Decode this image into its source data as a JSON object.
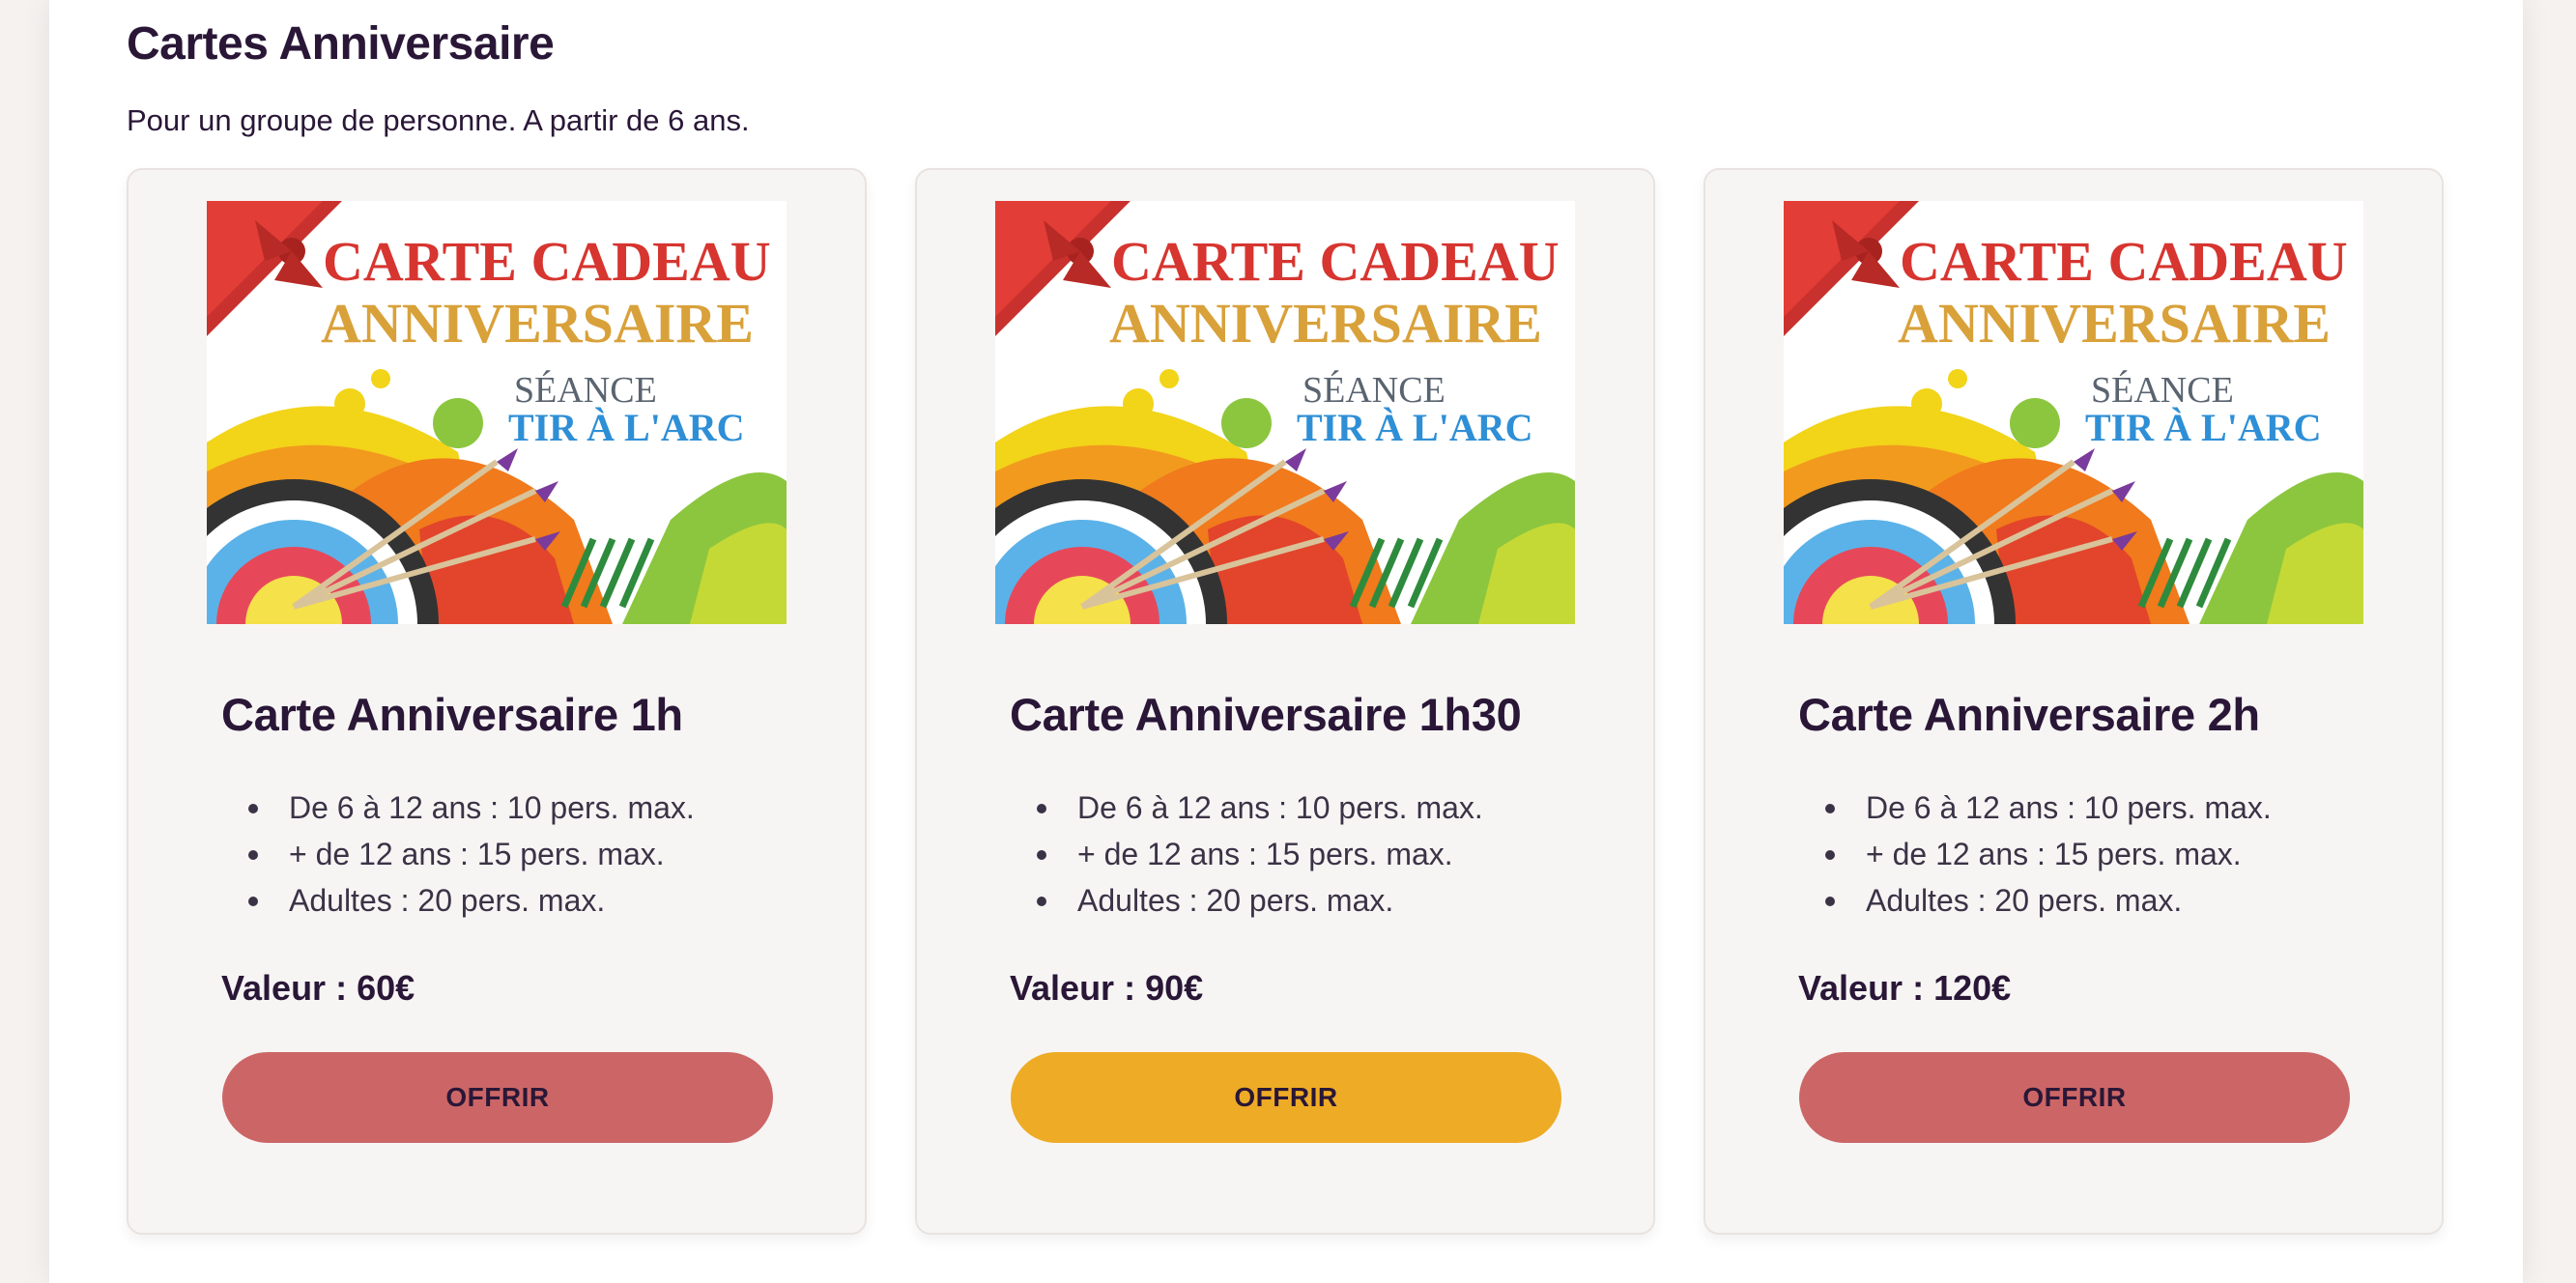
{
  "section": {
    "title": "Cartes Anniversaire",
    "subtitle": "Pour un groupe de personne. A partir de 6 ans."
  },
  "image_text": {
    "line1": "CARTE CADEAU",
    "line2": "ANNIVERSAIRE",
    "line3": "SÉANCE",
    "line4": "TIR À L'ARC"
  },
  "cards": [
    {
      "title": "Carte Anniversaire 1h",
      "features": [
        "De 6 à 12 ans : 10 pers. max.",
        "+ de 12 ans : 15 pers. max.",
        "Adultes : 20 pers. max."
      ],
      "price": "Valeur : 60€",
      "button": "OFFRIR",
      "button_color": "#cc6666"
    },
    {
      "title": "Carte Anniversaire 1h30",
      "features": [
        "De 6 à 12 ans : 10 pers. max.",
        "+ de 12 ans : 15 pers. max.",
        "Adultes : 20 pers. max."
      ],
      "price": "Valeur : 90€",
      "button": "OFFRIR",
      "button_color": "#eeab25"
    },
    {
      "title": "Carte Anniversaire 2h",
      "features": [
        "De 6 à 12 ans : 10 pers. max.",
        "+ de 12 ans : 15 pers. max.",
        "Adultes : 20 pers. max."
      ],
      "price": "Valeur : 120€",
      "button": "OFFRIR",
      "button_color": "#cc6666"
    }
  ],
  "colors": {
    "heading": "#2a1737",
    "card_bg": "#f7f5f4",
    "button_red": "#cc6666",
    "button_yellow": "#eeab25"
  }
}
